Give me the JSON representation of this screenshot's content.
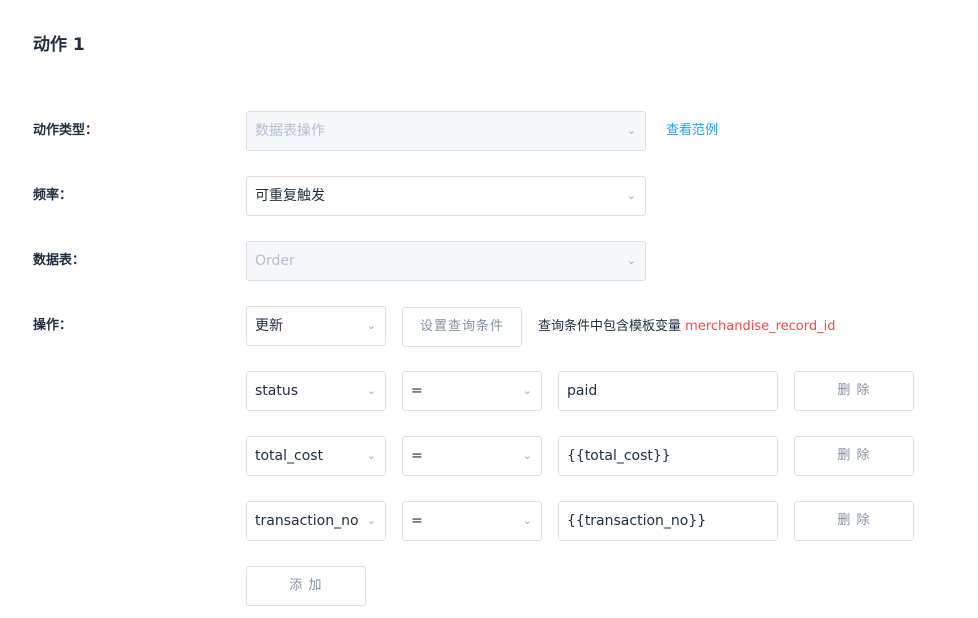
{
  "title": "动作 1",
  "labels": {
    "action_type": "动作类型：",
    "frequency": "频率：",
    "table": "数据表：",
    "operation": "操作："
  },
  "action_type": {
    "value": "数据表操作",
    "link": "查看范例"
  },
  "frequency": {
    "value": "可重复触发"
  },
  "table": {
    "value": "Order"
  },
  "operation": {
    "value": "更新",
    "query_button": "设置查询条件",
    "hint_prefix": "查询条件中包含模板变量",
    "hint_variable": "merchandise_record_id"
  },
  "rows": [
    {
      "field": "status",
      "operator": "=",
      "value": "paid",
      "delete_label": "删 除"
    },
    {
      "field": "total_cost",
      "operator": "=",
      "value": "{{total_cost}}",
      "delete_label": "删 除"
    },
    {
      "field": "transaction_no",
      "operator": "=",
      "value": "{{transaction_no}}",
      "delete_label": "删 除"
    }
  ],
  "add_label": "添 加",
  "icons": {
    "caret": "chevron-down-icon"
  },
  "colors": {
    "accent": "#20a0ff",
    "variable": "#ff4949",
    "border": "#dcdfe6",
    "disabled_bg": "#f5f7fa"
  }
}
